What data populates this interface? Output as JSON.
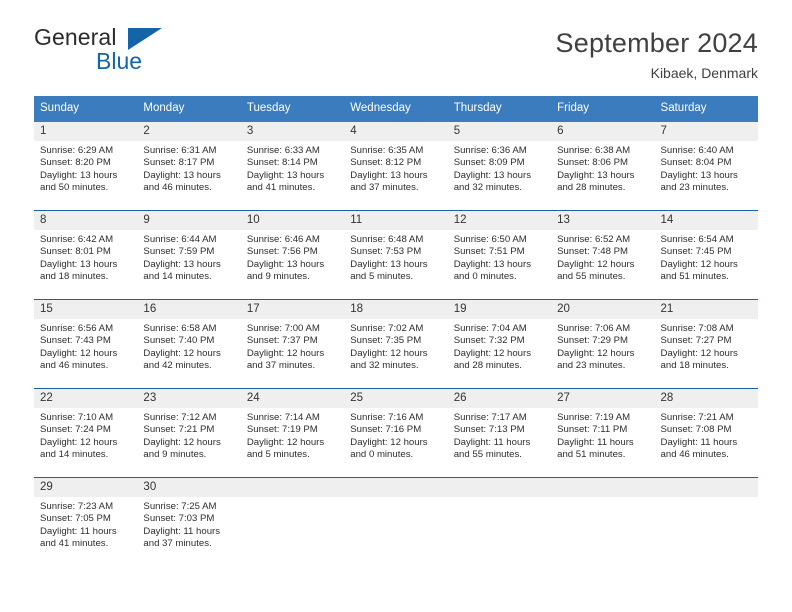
{
  "logo": {
    "word1": "General",
    "word2": "Blue",
    "accent_color": "#1464aa"
  },
  "header": {
    "title": "September 2024",
    "subtitle": "Kibaek, Denmark"
  },
  "calendar": {
    "header_bg": "#3b7cbe",
    "daynum_bg": "#efefef",
    "row_divider": "#1b5fa4",
    "weekdays": [
      "Sunday",
      "Monday",
      "Tuesday",
      "Wednesday",
      "Thursday",
      "Friday",
      "Saturday"
    ],
    "weeks": [
      [
        {
          "day": "1",
          "sunrise": "Sunrise: 6:29 AM",
          "sunset": "Sunset: 8:20 PM",
          "daylight1": "Daylight: 13 hours",
          "daylight2": "and 50 minutes."
        },
        {
          "day": "2",
          "sunrise": "Sunrise: 6:31 AM",
          "sunset": "Sunset: 8:17 PM",
          "daylight1": "Daylight: 13 hours",
          "daylight2": "and 46 minutes."
        },
        {
          "day": "3",
          "sunrise": "Sunrise: 6:33 AM",
          "sunset": "Sunset: 8:14 PM",
          "daylight1": "Daylight: 13 hours",
          "daylight2": "and 41 minutes."
        },
        {
          "day": "4",
          "sunrise": "Sunrise: 6:35 AM",
          "sunset": "Sunset: 8:12 PM",
          "daylight1": "Daylight: 13 hours",
          "daylight2": "and 37 minutes."
        },
        {
          "day": "5",
          "sunrise": "Sunrise: 6:36 AM",
          "sunset": "Sunset: 8:09 PM",
          "daylight1": "Daylight: 13 hours",
          "daylight2": "and 32 minutes."
        },
        {
          "day": "6",
          "sunrise": "Sunrise: 6:38 AM",
          "sunset": "Sunset: 8:06 PM",
          "daylight1": "Daylight: 13 hours",
          "daylight2": "and 28 minutes."
        },
        {
          "day": "7",
          "sunrise": "Sunrise: 6:40 AM",
          "sunset": "Sunset: 8:04 PM",
          "daylight1": "Daylight: 13 hours",
          "daylight2": "and 23 minutes."
        }
      ],
      [
        {
          "day": "8",
          "sunrise": "Sunrise: 6:42 AM",
          "sunset": "Sunset: 8:01 PM",
          "daylight1": "Daylight: 13 hours",
          "daylight2": "and 18 minutes."
        },
        {
          "day": "9",
          "sunrise": "Sunrise: 6:44 AM",
          "sunset": "Sunset: 7:59 PM",
          "daylight1": "Daylight: 13 hours",
          "daylight2": "and 14 minutes."
        },
        {
          "day": "10",
          "sunrise": "Sunrise: 6:46 AM",
          "sunset": "Sunset: 7:56 PM",
          "daylight1": "Daylight: 13 hours",
          "daylight2": "and 9 minutes."
        },
        {
          "day": "11",
          "sunrise": "Sunrise: 6:48 AM",
          "sunset": "Sunset: 7:53 PM",
          "daylight1": "Daylight: 13 hours",
          "daylight2": "and 5 minutes."
        },
        {
          "day": "12",
          "sunrise": "Sunrise: 6:50 AM",
          "sunset": "Sunset: 7:51 PM",
          "daylight1": "Daylight: 13 hours",
          "daylight2": "and 0 minutes."
        },
        {
          "day": "13",
          "sunrise": "Sunrise: 6:52 AM",
          "sunset": "Sunset: 7:48 PM",
          "daylight1": "Daylight: 12 hours",
          "daylight2": "and 55 minutes."
        },
        {
          "day": "14",
          "sunrise": "Sunrise: 6:54 AM",
          "sunset": "Sunset: 7:45 PM",
          "daylight1": "Daylight: 12 hours",
          "daylight2": "and 51 minutes."
        }
      ],
      [
        {
          "day": "15",
          "sunrise": "Sunrise: 6:56 AM",
          "sunset": "Sunset: 7:43 PM",
          "daylight1": "Daylight: 12 hours",
          "daylight2": "and 46 minutes."
        },
        {
          "day": "16",
          "sunrise": "Sunrise: 6:58 AM",
          "sunset": "Sunset: 7:40 PM",
          "daylight1": "Daylight: 12 hours",
          "daylight2": "and 42 minutes."
        },
        {
          "day": "17",
          "sunrise": "Sunrise: 7:00 AM",
          "sunset": "Sunset: 7:37 PM",
          "daylight1": "Daylight: 12 hours",
          "daylight2": "and 37 minutes."
        },
        {
          "day": "18",
          "sunrise": "Sunrise: 7:02 AM",
          "sunset": "Sunset: 7:35 PM",
          "daylight1": "Daylight: 12 hours",
          "daylight2": "and 32 minutes."
        },
        {
          "day": "19",
          "sunrise": "Sunrise: 7:04 AM",
          "sunset": "Sunset: 7:32 PM",
          "daylight1": "Daylight: 12 hours",
          "daylight2": "and 28 minutes."
        },
        {
          "day": "20",
          "sunrise": "Sunrise: 7:06 AM",
          "sunset": "Sunset: 7:29 PM",
          "daylight1": "Daylight: 12 hours",
          "daylight2": "and 23 minutes."
        },
        {
          "day": "21",
          "sunrise": "Sunrise: 7:08 AM",
          "sunset": "Sunset: 7:27 PM",
          "daylight1": "Daylight: 12 hours",
          "daylight2": "and 18 minutes."
        }
      ],
      [
        {
          "day": "22",
          "sunrise": "Sunrise: 7:10 AM",
          "sunset": "Sunset: 7:24 PM",
          "daylight1": "Daylight: 12 hours",
          "daylight2": "and 14 minutes."
        },
        {
          "day": "23",
          "sunrise": "Sunrise: 7:12 AM",
          "sunset": "Sunset: 7:21 PM",
          "daylight1": "Daylight: 12 hours",
          "daylight2": "and 9 minutes."
        },
        {
          "day": "24",
          "sunrise": "Sunrise: 7:14 AM",
          "sunset": "Sunset: 7:19 PM",
          "daylight1": "Daylight: 12 hours",
          "daylight2": "and 5 minutes."
        },
        {
          "day": "25",
          "sunrise": "Sunrise: 7:16 AM",
          "sunset": "Sunset: 7:16 PM",
          "daylight1": "Daylight: 12 hours",
          "daylight2": "and 0 minutes."
        },
        {
          "day": "26",
          "sunrise": "Sunrise: 7:17 AM",
          "sunset": "Sunset: 7:13 PM",
          "daylight1": "Daylight: 11 hours",
          "daylight2": "and 55 minutes."
        },
        {
          "day": "27",
          "sunrise": "Sunrise: 7:19 AM",
          "sunset": "Sunset: 7:11 PM",
          "daylight1": "Daylight: 11 hours",
          "daylight2": "and 51 minutes."
        },
        {
          "day": "28",
          "sunrise": "Sunrise: 7:21 AM",
          "sunset": "Sunset: 7:08 PM",
          "daylight1": "Daylight: 11 hours",
          "daylight2": "and 46 minutes."
        }
      ],
      [
        {
          "day": "29",
          "sunrise": "Sunrise: 7:23 AM",
          "sunset": "Sunset: 7:05 PM",
          "daylight1": "Daylight: 11 hours",
          "daylight2": "and 41 minutes."
        },
        {
          "day": "30",
          "sunrise": "Sunrise: 7:25 AM",
          "sunset": "Sunset: 7:03 PM",
          "daylight1": "Daylight: 11 hours",
          "daylight2": "and 37 minutes."
        },
        {
          "day": "",
          "sunrise": "",
          "sunset": "",
          "daylight1": "",
          "daylight2": ""
        },
        {
          "day": "",
          "sunrise": "",
          "sunset": "",
          "daylight1": "",
          "daylight2": ""
        },
        {
          "day": "",
          "sunrise": "",
          "sunset": "",
          "daylight1": "",
          "daylight2": ""
        },
        {
          "day": "",
          "sunrise": "",
          "sunset": "",
          "daylight1": "",
          "daylight2": ""
        },
        {
          "day": "",
          "sunrise": "",
          "sunset": "",
          "daylight1": "",
          "daylight2": ""
        }
      ]
    ]
  }
}
